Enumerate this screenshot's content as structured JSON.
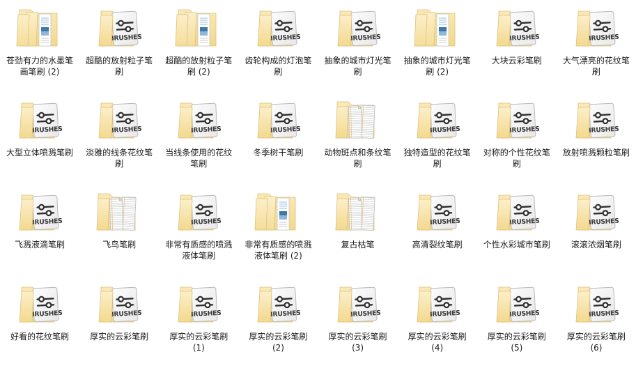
{
  "view": {
    "type": "file-explorer-icon-grid",
    "background_color": "#ffffff",
    "columns": 8,
    "rows": 4,
    "total_items": 32,
    "folder_color": "#f7dc92",
    "folder_color_dark": "#e8c870",
    "card_color": "#f2f2f2",
    "label_color": "#1a1a1a"
  },
  "icons": {
    "brushes_card": {
      "name": "folder-brushes-card-icon",
      "caption": "BRUSHES"
    },
    "image_stack": {
      "name": "folder-image-stack-icon"
    },
    "document_stack": {
      "name": "folder-document-stack-icon"
    }
  },
  "items": [
    {
      "label": "苍劲有力的水墨笔画笔刷 (2)",
      "icon": "image_stack"
    },
    {
      "label": "超酷的放射粒子笔刷",
      "icon": "brushes_card"
    },
    {
      "label": "超酷的放射粒子笔刷 (2)",
      "icon": "image_stack"
    },
    {
      "label": "齿轮构成的灯泡笔刷",
      "icon": "brushes_card"
    },
    {
      "label": "抽象的城市灯光笔刷",
      "icon": "brushes_card"
    },
    {
      "label": "抽象的城市灯光笔刷 (2)",
      "icon": "image_stack"
    },
    {
      "label": "大块云彩笔刷",
      "icon": "brushes_card"
    },
    {
      "label": "大气漂亮的花纹笔刷",
      "icon": "brushes_card"
    },
    {
      "label": "大型立体喷溅笔刷",
      "icon": "brushes_card"
    },
    {
      "label": "淡雅的线条花纹笔刷",
      "icon": "brushes_card"
    },
    {
      "label": "当线条使用的花纹笔刷",
      "icon": "brushes_card"
    },
    {
      "label": "冬季树干笔刷",
      "icon": "brushes_card"
    },
    {
      "label": "动物斑点和条纹笔刷",
      "icon": "document_stack"
    },
    {
      "label": "独特造型的花纹笔刷",
      "icon": "brushes_card"
    },
    {
      "label": "对称的个性花纹笔刷",
      "icon": "brushes_card"
    },
    {
      "label": "放射喷溅颗粒笔刷",
      "icon": "brushes_card"
    },
    {
      "label": "飞溅液滴笔刷",
      "icon": "brushes_card"
    },
    {
      "label": "飞鸟笔刷",
      "icon": "document_stack"
    },
    {
      "label": "非常有质感的喷溅液体笔刷",
      "icon": "brushes_card"
    },
    {
      "label": "非常有质感的喷溅液体笔刷 (2)",
      "icon": "image_stack"
    },
    {
      "label": "复古枯笔",
      "icon": "document_stack"
    },
    {
      "label": "高清裂纹笔刷",
      "icon": "brushes_card"
    },
    {
      "label": "个性水彩城市笔刷",
      "icon": "brushes_card"
    },
    {
      "label": "滚滚浓烟笔刷",
      "icon": "brushes_card"
    },
    {
      "label": "好看的花纹笔刷",
      "icon": "brushes_card"
    },
    {
      "label": "厚实的云彩笔刷",
      "icon": "brushes_card"
    },
    {
      "label": "厚实的云彩笔刷 (1)",
      "icon": "brushes_card"
    },
    {
      "label": "厚实的云彩笔刷 (2)",
      "icon": "brushes_card"
    },
    {
      "label": "厚实的云彩笔刷 (3)",
      "icon": "brushes_card"
    },
    {
      "label": "厚实的云彩笔刷 (4)",
      "icon": "brushes_card"
    },
    {
      "label": "厚实的云彩笔刷 (5)",
      "icon": "brushes_card"
    },
    {
      "label": "厚实的云彩笔刷 (6)",
      "icon": "brushes_card"
    }
  ]
}
